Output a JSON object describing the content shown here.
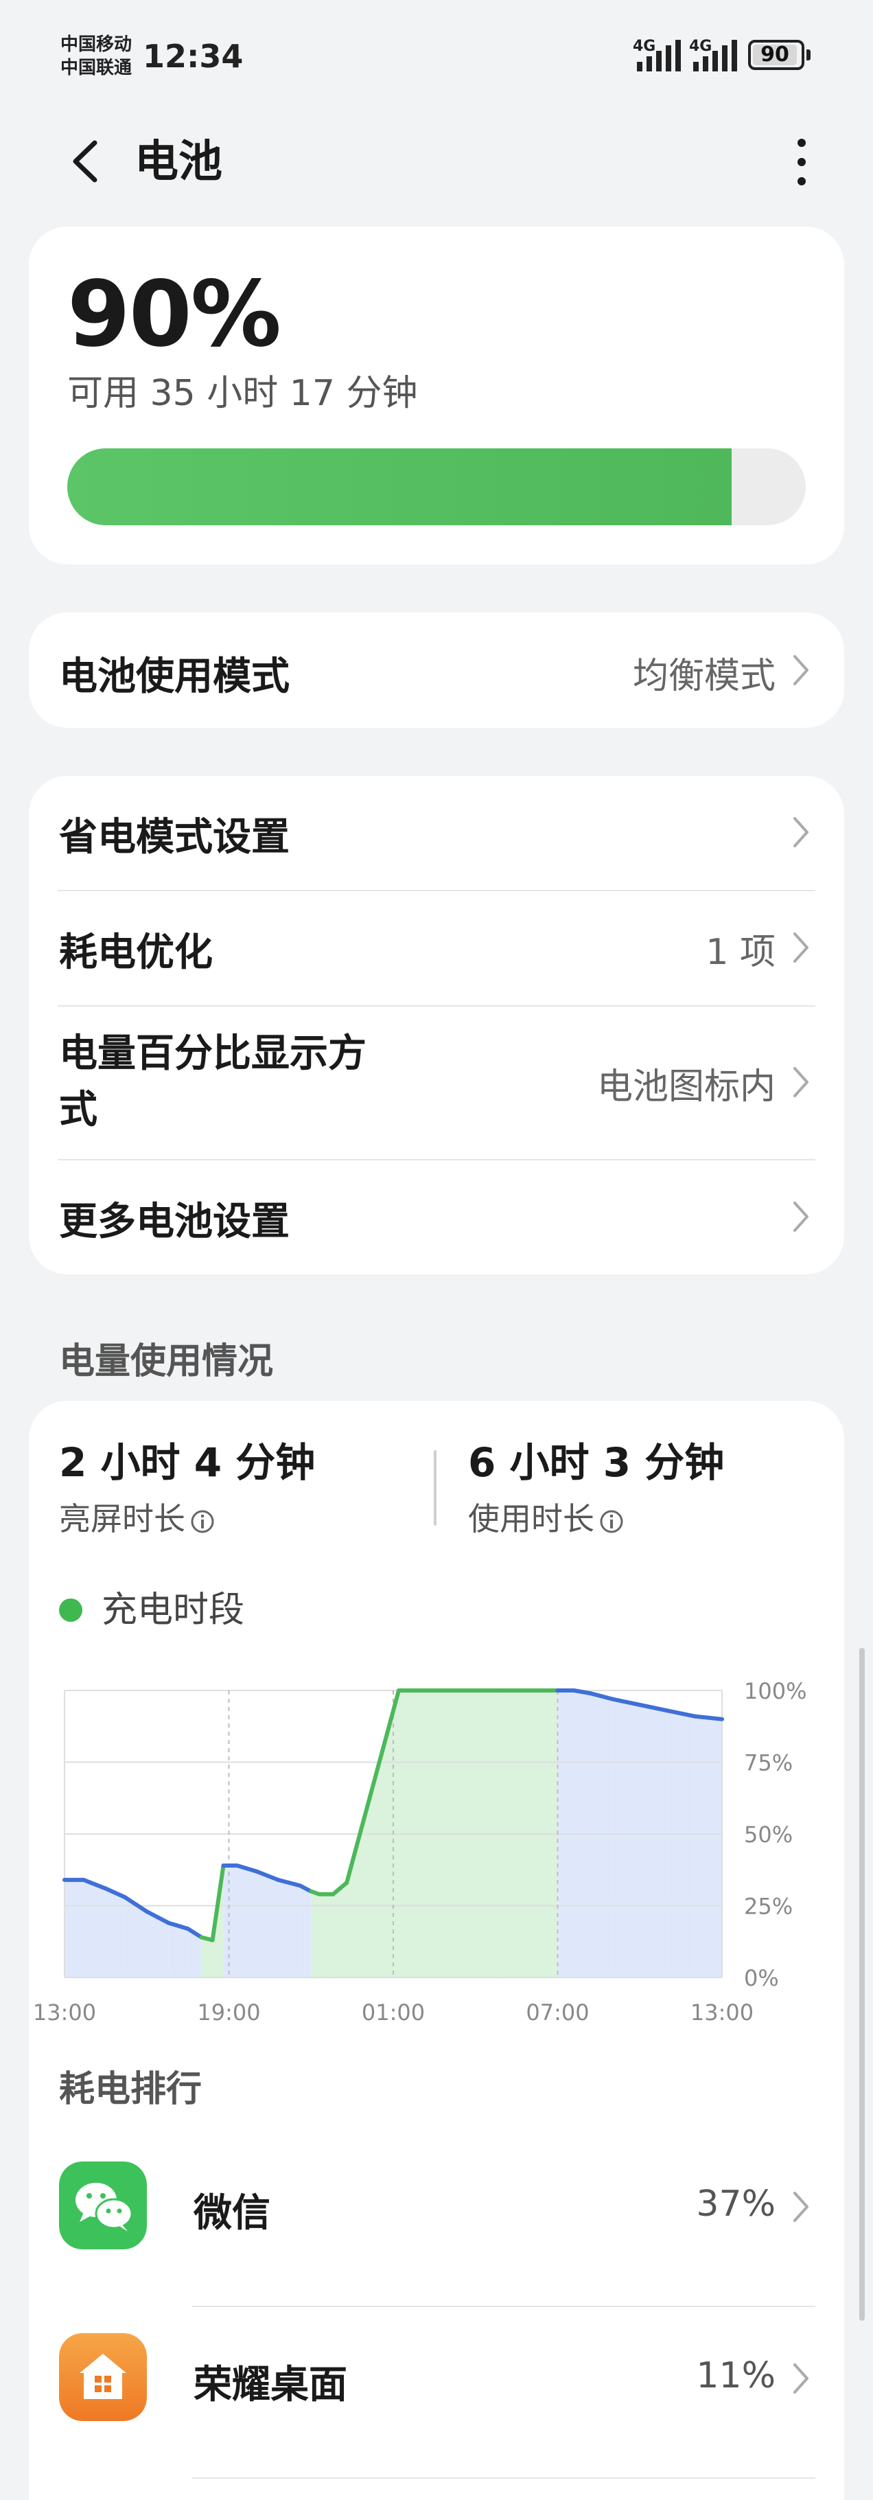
{
  "status_bar": {
    "carrier_1": "中国移动",
    "carrier_2": "中国联通",
    "time": "12:34",
    "network_1": "4G",
    "network_2": "4G",
    "battery_level": "90"
  },
  "header": {
    "title": "电池",
    "back_icon": "chevron-left-icon",
    "more_icon": "more-vertical-icon"
  },
  "battery": {
    "percent": "90%",
    "remaining": "可用 35 小时 17 分钟",
    "fill_fraction": 0.9
  },
  "mode_card": {
    "label": "电池使用模式",
    "value": "均衡模式"
  },
  "settings": [
    {
      "label": "省电模式设置",
      "value": ""
    },
    {
      "label": "耗电优化",
      "value": "1 项"
    },
    {
      "label_line1": "电量百分比显示方",
      "label_line2": "式",
      "value": "电池图标内"
    },
    {
      "label": "更多电池设置",
      "value": ""
    }
  ],
  "usage": {
    "section_title": "电量使用情况",
    "screen_time": "2 小时 4 分钟",
    "screen_time_label": "亮屏时长",
    "use_time": "6 小时 3 分钟",
    "use_time_label": "使用时长",
    "legend": "充电时段"
  },
  "chart_data": {
    "type": "area",
    "x_ticks": [
      "13:00",
      "19:00",
      "01:00",
      "07:00",
      "13:00"
    ],
    "y_ticks": [
      "100%",
      "75%",
      "50%",
      "25%",
      "0%"
    ],
    "ylim": [
      0,
      100
    ],
    "x_range_hours": [
      0,
      24
    ],
    "grid": true,
    "series": [
      {
        "x": [
          0,
          0.7,
          1.5,
          2.2,
          3.0,
          3.8,
          4.5,
          5.0,
          5.4,
          5.8,
          6.3,
          7.0,
          7.8,
          8.6,
          9.0,
          9.3,
          9.8,
          10.3,
          12.2,
          16.0,
          18.0,
          18.6,
          19.2,
          20.0,
          21.0,
          22.0,
          23.0,
          24.0
        ],
        "y": [
          34,
          34,
          31,
          28,
          23,
          19,
          17,
          14,
          13,
          39,
          39,
          37,
          34,
          32,
          30,
          29,
          29,
          33,
          100,
          100,
          100,
          100,
          99,
          97,
          95,
          93,
          91,
          90
        ]
      }
    ],
    "charging_intervals": [
      [
        5.0,
        5.8
      ],
      [
        9.0,
        18.0
      ]
    ],
    "colors": {
      "line_discharge": "#3f6fd8",
      "line_charge": "#4cb85a",
      "fill_discharge": "#dbe6fb",
      "fill_charge": "#d7f1d9"
    }
  },
  "ranking": {
    "title": "耗电排行",
    "apps": [
      {
        "name": "微信",
        "pct": "37%",
        "icon": "wechat-icon"
      },
      {
        "name": "荣耀桌面",
        "pct": "11%",
        "icon": "home-launcher-icon"
      }
    ]
  }
}
